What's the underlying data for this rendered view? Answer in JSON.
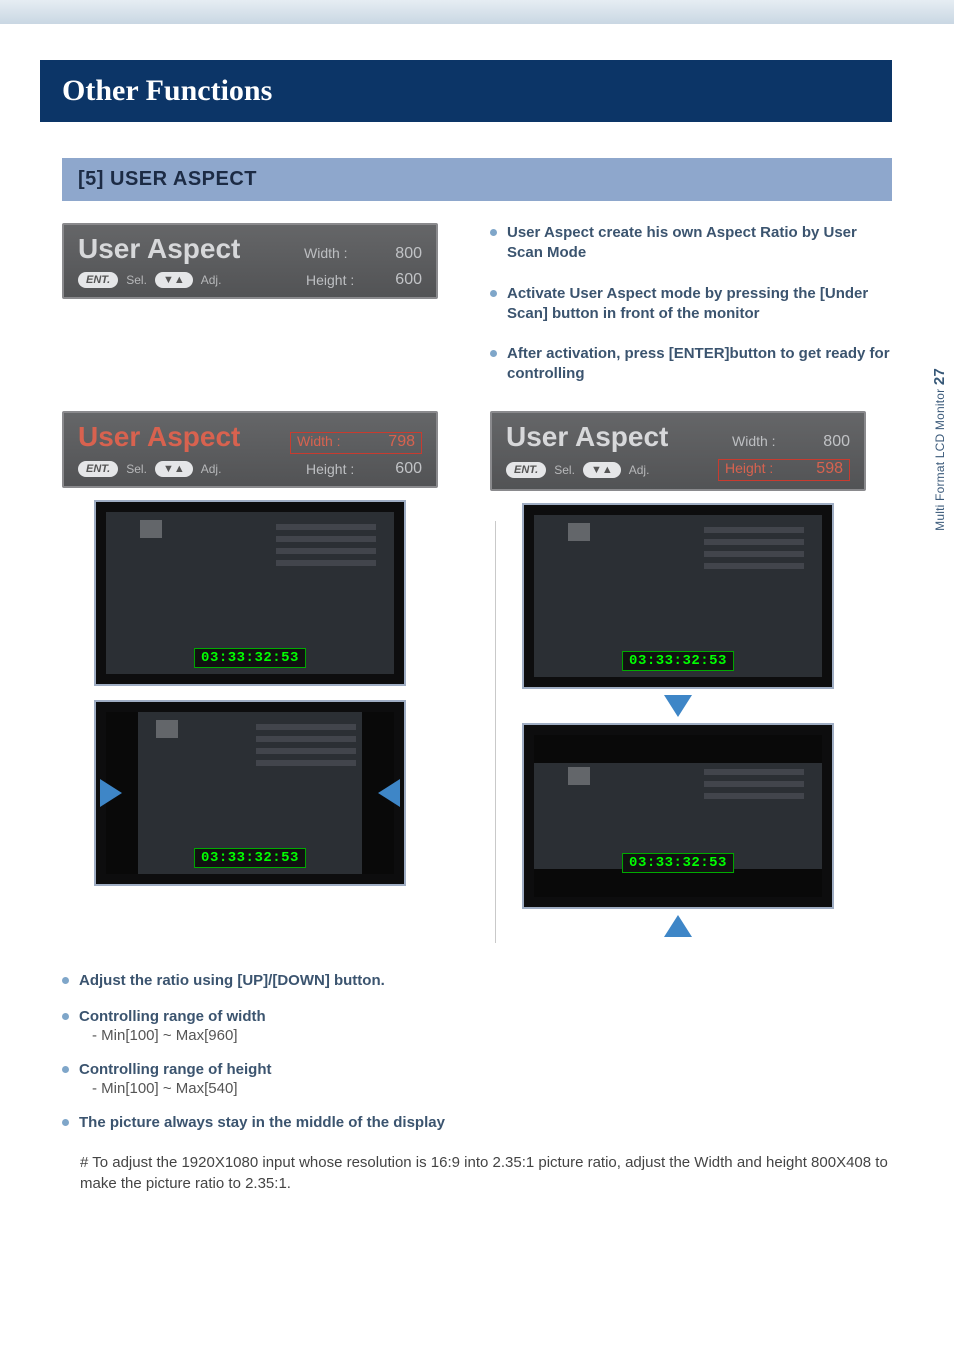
{
  "page": {
    "title": "Other Functions",
    "section_heading": "[5] USER ASPECT",
    "side_tab_text": "Multi Format LCD Monitor",
    "side_tab_page": "27"
  },
  "osd_main": {
    "title": "User Aspect",
    "width_label": "Width :",
    "width_val": "800",
    "ent": "ENT.",
    "sel": "Sel.",
    "arrows": "▼▲",
    "adj": "Adj.",
    "height_label": "Height :",
    "height_val": "600"
  },
  "osd_left": {
    "title": "User Aspect",
    "width_label": "Width :",
    "width_val": "798",
    "height_label": "Height :",
    "height_val": "600"
  },
  "osd_right": {
    "title": "User Aspect",
    "width_label": "Width :",
    "width_val": "800",
    "height_label": "Height :",
    "height_val": "598"
  },
  "timecode": "03:33:32:53",
  "bullets_right": [
    "User Aspect create his own Aspect Ratio by User Scan Mode",
    "Activate User Aspect mode by pressing the [Under Scan] button in front of the monitor",
    "After activation, press [ENTER]button to get ready for controlling"
  ],
  "bullets_lower": [
    "Adjust the ratio using [UP]/[DOWN] button.",
    "Controlling range of width",
    "Controlling range of height",
    "The picture always stay in the middle of the display"
  ],
  "sub_width": "- Min[100] ~ Max[960]",
  "sub_height": "- Min[100] ~ Max[540]",
  "note": "# To adjust the 1920X1080 input whose resolution is 16:9 into 2.35:1 picture ratio, adjust the Width and height 800X408 to make the picture ratio to 2.35:1."
}
